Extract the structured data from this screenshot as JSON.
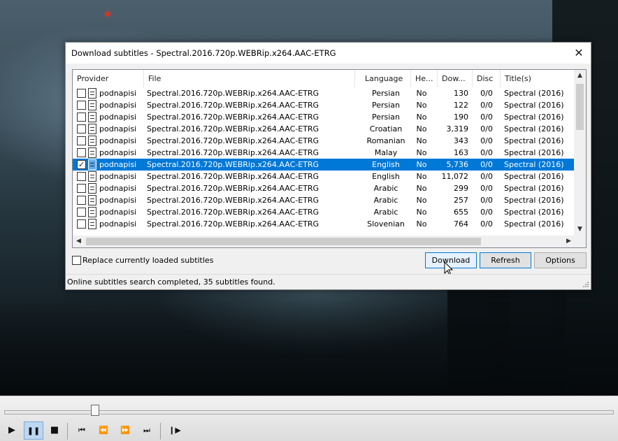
{
  "dialog": {
    "title": "Download subtitles - Spectral.2016.720p.WEBRip.x264.AAC-ETRG",
    "close": "✕"
  },
  "columns": [
    "Provider",
    "File",
    "Language",
    "He...",
    "Dow...",
    "Disc",
    "Title(s)"
  ],
  "rows": [
    {
      "checked": false,
      "provider": "podnapisi",
      "file": "Spectral.2016.720p.WEBRip.x264.AAC-ETRG",
      "language": "Persian",
      "hearing": "No",
      "downloads": "130",
      "disc": "0/0",
      "title": "Spectral (2016)"
    },
    {
      "checked": false,
      "provider": "podnapisi",
      "file": "Spectral.2016.720p.WEBRip.x264.AAC-ETRG",
      "language": "Persian",
      "hearing": "No",
      "downloads": "122",
      "disc": "0/0",
      "title": "Spectral (2016)"
    },
    {
      "checked": false,
      "provider": "podnapisi",
      "file": "Spectral.2016.720p.WEBRip.x264.AAC-ETRG",
      "language": "Persian",
      "hearing": "No",
      "downloads": "190",
      "disc": "0/0",
      "title": "Spectral (2016)"
    },
    {
      "checked": false,
      "provider": "podnapisi",
      "file": "Spectral.2016.720p.WEBRip.x264.AAC-ETRG",
      "language": "Croatian",
      "hearing": "No",
      "downloads": "3,319",
      "disc": "0/0",
      "title": "Spectral (2016)"
    },
    {
      "checked": false,
      "provider": "podnapisi",
      "file": "Spectral.2016.720p.WEBRip.x264.AAC-ETRG",
      "language": "Romanian",
      "hearing": "No",
      "downloads": "343",
      "disc": "0/0",
      "title": "Spectral (2016)"
    },
    {
      "checked": false,
      "provider": "podnapisi",
      "file": "Spectral.2016.720p.WEBRip.x264.AAC-ETRG",
      "language": "Malay",
      "hearing": "No",
      "downloads": "163",
      "disc": "0/0",
      "title": "Spectral (2016)"
    },
    {
      "checked": true,
      "selected": true,
      "provider": "podnapisi",
      "file": "Spectral.2016.720p.WEBRip.x264.AAC-ETRG",
      "language": "English",
      "hearing": "No",
      "downloads": "5,736",
      "disc": "0/0",
      "title": "Spectral (2016)"
    },
    {
      "checked": false,
      "provider": "podnapisi",
      "file": "Spectral.2016.720p.WEBRip.x264.AAC-ETRG",
      "language": "English",
      "hearing": "No",
      "downloads": "11,072",
      "disc": "0/0",
      "title": "Spectral (2016)"
    },
    {
      "checked": false,
      "provider": "podnapisi",
      "file": "Spectral.2016.720p.WEBRip.x264.AAC-ETRG",
      "language": "Arabic",
      "hearing": "No",
      "downloads": "299",
      "disc": "0/0",
      "title": "Spectral (2016)"
    },
    {
      "checked": false,
      "provider": "podnapisi",
      "file": "Spectral.2016.720p.WEBRip.x264.AAC-ETRG",
      "language": "Arabic",
      "hearing": "No",
      "downloads": "257",
      "disc": "0/0",
      "title": "Spectral (2016)"
    },
    {
      "checked": false,
      "provider": "podnapisi",
      "file": "Spectral.2016.720p.WEBRip.x264.AAC-ETRG",
      "language": "Arabic",
      "hearing": "No",
      "downloads": "655",
      "disc": "0/0",
      "title": "Spectral (2016)"
    },
    {
      "checked": false,
      "provider": "podnapisi",
      "file": "Spectral.2016.720p.WEBRip.x264.AAC-ETRG",
      "language": "Slovenian",
      "hearing": "No",
      "downloads": "764",
      "disc": "0/0",
      "title": "Spectral (2016)"
    }
  ],
  "replace_label": "Replace currently loaded subtitles",
  "buttons": {
    "download": "Download",
    "refresh": "Refresh",
    "options": "Options"
  },
  "status": "Online subtitles search completed, 35 subtitles found.",
  "player": {
    "play": "▶",
    "pause": "❚❚",
    "stop": "■",
    "prev": "⏮",
    "rewind": "⏪",
    "forward": "⏩",
    "next": "⏭",
    "frame_step": "❙▶",
    "seek_position": 0.14
  },
  "colors": {
    "selection": "#0078d7",
    "accent": "#0078d7"
  }
}
